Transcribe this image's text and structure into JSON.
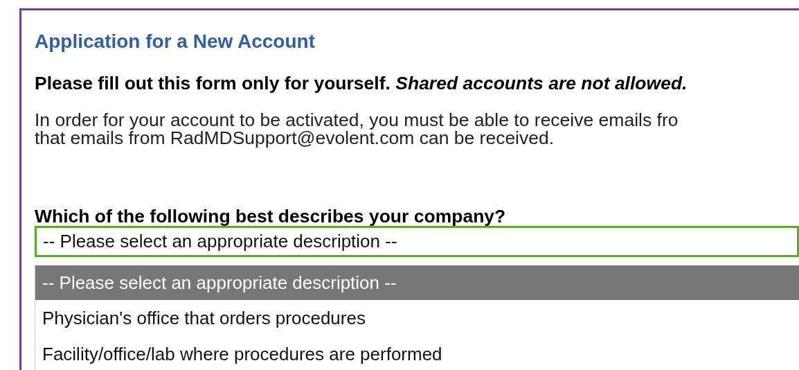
{
  "form": {
    "title": "Application for a New Account",
    "notice": "Please fill out this form only for yourself. *Shared accounts are not allowed.*",
    "info_lines": [
      "In order for your account to be activated, you must be able to receive emails fro",
      "that emails from RadMDSupport@evolent.com can be received."
    ],
    "question": "Which of the following best describes your company?",
    "select": {
      "value": "-- Please select an appropriate description --"
    },
    "options": [
      {
        "label": "-- Please select an appropriate description --",
        "selected": true
      },
      {
        "label": "Physician's office that orders procedures",
        "selected": false
      },
      {
        "label": "Facility/office/lab where procedures are performed",
        "selected": false
      }
    ]
  }
}
